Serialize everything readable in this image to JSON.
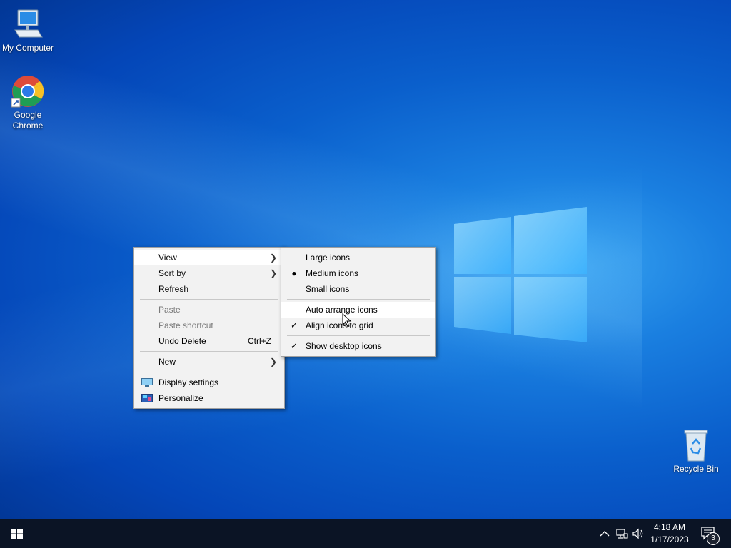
{
  "desktop": {
    "icons": [
      {
        "label": "My Computer",
        "icon": "computer-icon"
      },
      {
        "label": "Google\nChrome",
        "icon": "chrome-icon"
      },
      {
        "label": "Recycle Bin",
        "icon": "recycle-bin-icon"
      }
    ]
  },
  "context_menu": {
    "items": {
      "view": {
        "label": "View",
        "has_submenu": true,
        "state": "highlighted"
      },
      "sort_by": {
        "label": "Sort by",
        "has_submenu": true
      },
      "refresh": {
        "label": "Refresh"
      },
      "paste": {
        "label": "Paste",
        "enabled": false
      },
      "paste_shortcut": {
        "label": "Paste shortcut",
        "enabled": false
      },
      "undo_delete": {
        "label": "Undo Delete",
        "shortcut": "Ctrl+Z"
      },
      "new": {
        "label": "New",
        "has_submenu": true
      },
      "display_settings": {
        "label": "Display settings",
        "icon": "display-icon"
      },
      "personalize": {
        "label": "Personalize",
        "icon": "personalize-icon"
      }
    }
  },
  "view_submenu": {
    "items": {
      "large_icons": {
        "label": "Large icons",
        "selected": false
      },
      "medium_icons": {
        "label": "Medium icons",
        "selected": true,
        "mark": "●"
      },
      "small_icons": {
        "label": "Small icons",
        "selected": false
      },
      "auto_arrange": {
        "label": "Auto arrange icons",
        "checked": false,
        "state": "hover"
      },
      "align_to_grid": {
        "label": "Align icons to grid",
        "checked": true,
        "mark": "✓"
      },
      "show_desktop_icons": {
        "label": "Show desktop icons",
        "checked": true,
        "mark": "✓"
      }
    }
  },
  "taskbar": {
    "clock": {
      "time": "4:18 AM",
      "date": "1/17/2023"
    },
    "notification_count": "3",
    "tray_icons": [
      "chevron-up-icon",
      "network-icon",
      "volume-icon",
      "action-center-icon"
    ]
  },
  "colors": {
    "taskbar_bg": "#0b1425",
    "menu_bg": "#f2f2f2",
    "menu_hover": "#ffffff",
    "disabled_text": "#7a7a7a",
    "desktop_accent": "#0a5fcc"
  }
}
